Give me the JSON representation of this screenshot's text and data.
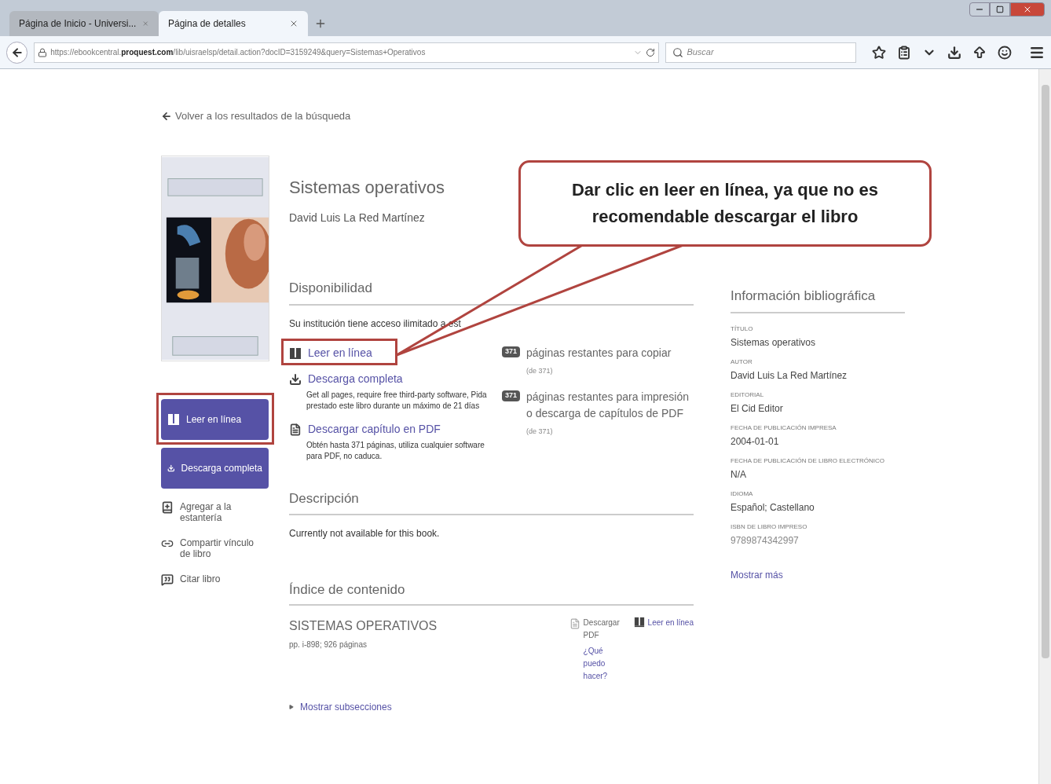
{
  "browser": {
    "tabs": [
      {
        "title": "Página de Inicio - Universi...",
        "selected": false
      },
      {
        "title": "Página de detalles",
        "selected": true
      }
    ],
    "url": {
      "prefix": "https://ebookcentral.",
      "domain": "proquest.com",
      "path": "/lib/uisraelsp/detail.action?docID=3159249&query=Sistemas+Operativos"
    },
    "search": {
      "placeholder": "Buscar"
    }
  },
  "page": {
    "back_link": "Volver a los resultados de la búsqueda",
    "book": {
      "title": "Sistemas operativos",
      "author": "David Luis La Red Martínez"
    },
    "side_buttons": [
      {
        "label": "Leer en línea",
        "kind": "read",
        "highlighted": true
      },
      {
        "label": "Descarga completa",
        "kind": "download",
        "highlighted": false
      }
    ],
    "side_links": [
      {
        "label": "Agregar a la estantería",
        "kind": "shelf"
      },
      {
        "label": "Compartir vínculo de libro",
        "kind": "share"
      },
      {
        "label": "Citar libro",
        "kind": "cite"
      }
    ],
    "availability": {
      "heading": "Disponibilidad",
      "note": "Su institución tiene acceso ilimitado a est",
      "options": [
        {
          "label": "Leer en línea",
          "kind": "read",
          "highlighted": true
        },
        {
          "label": "Descarga completa",
          "kind": "download",
          "highlighted": false,
          "description": "Get all pages, require free third-party software, Pida prestado este libro durante un máximo de 21 días"
        },
        {
          "label": "Descargar capítulo en PDF",
          "kind": "pdf",
          "highlighted": false,
          "description": "Obtén hasta 371 páginas, utiliza cualquier software para PDF, no caduca."
        }
      ],
      "quotas": [
        {
          "count": "371",
          "text": "páginas restantes para copiar",
          "total": "(de 371)"
        },
        {
          "count": "371",
          "text": "páginas restantes para impresión o descarga de capítulos de PDF",
          "total": "(de 371)"
        }
      ]
    },
    "description": {
      "heading": "Descripción",
      "text": "Currently not available for this book."
    },
    "toc": {
      "heading": "Índice de contenido",
      "entries": [
        {
          "title": "SISTEMAS OPERATIVOS",
          "pages": "pp. i-898; 926 páginas",
          "download": "Descargar PDF",
          "help": "¿Qué puedo hacer?",
          "read": "Leer en línea"
        }
      ],
      "more": "Mostrar subsecciones"
    },
    "bibliography": {
      "heading": "Información bibliográfica",
      "fields": [
        {
          "label": "TÍTULO",
          "value": "Sistemas operativos"
        },
        {
          "label": "AUTOR",
          "value": "David Luis La Red Martínez"
        },
        {
          "label": "EDITORIAL",
          "value": "El Cid Editor"
        },
        {
          "label": "FECHA DE PUBLICACIÓN IMPRESA",
          "value": "2004-01-01"
        },
        {
          "label": "FECHA DE PUBLICACIÓN DE LIBRO ELECTRÓNICO",
          "value": "N/A"
        },
        {
          "label": "IDIOMA",
          "value": "Español; Castellano"
        },
        {
          "label": "ISBN DE LIBRO IMPRESO",
          "value": "9789874342997"
        }
      ],
      "more": "Mostrar más"
    }
  },
  "callout": {
    "text": "Dar clic en leer en línea, ya que no es recomendable descargar el libro"
  }
}
